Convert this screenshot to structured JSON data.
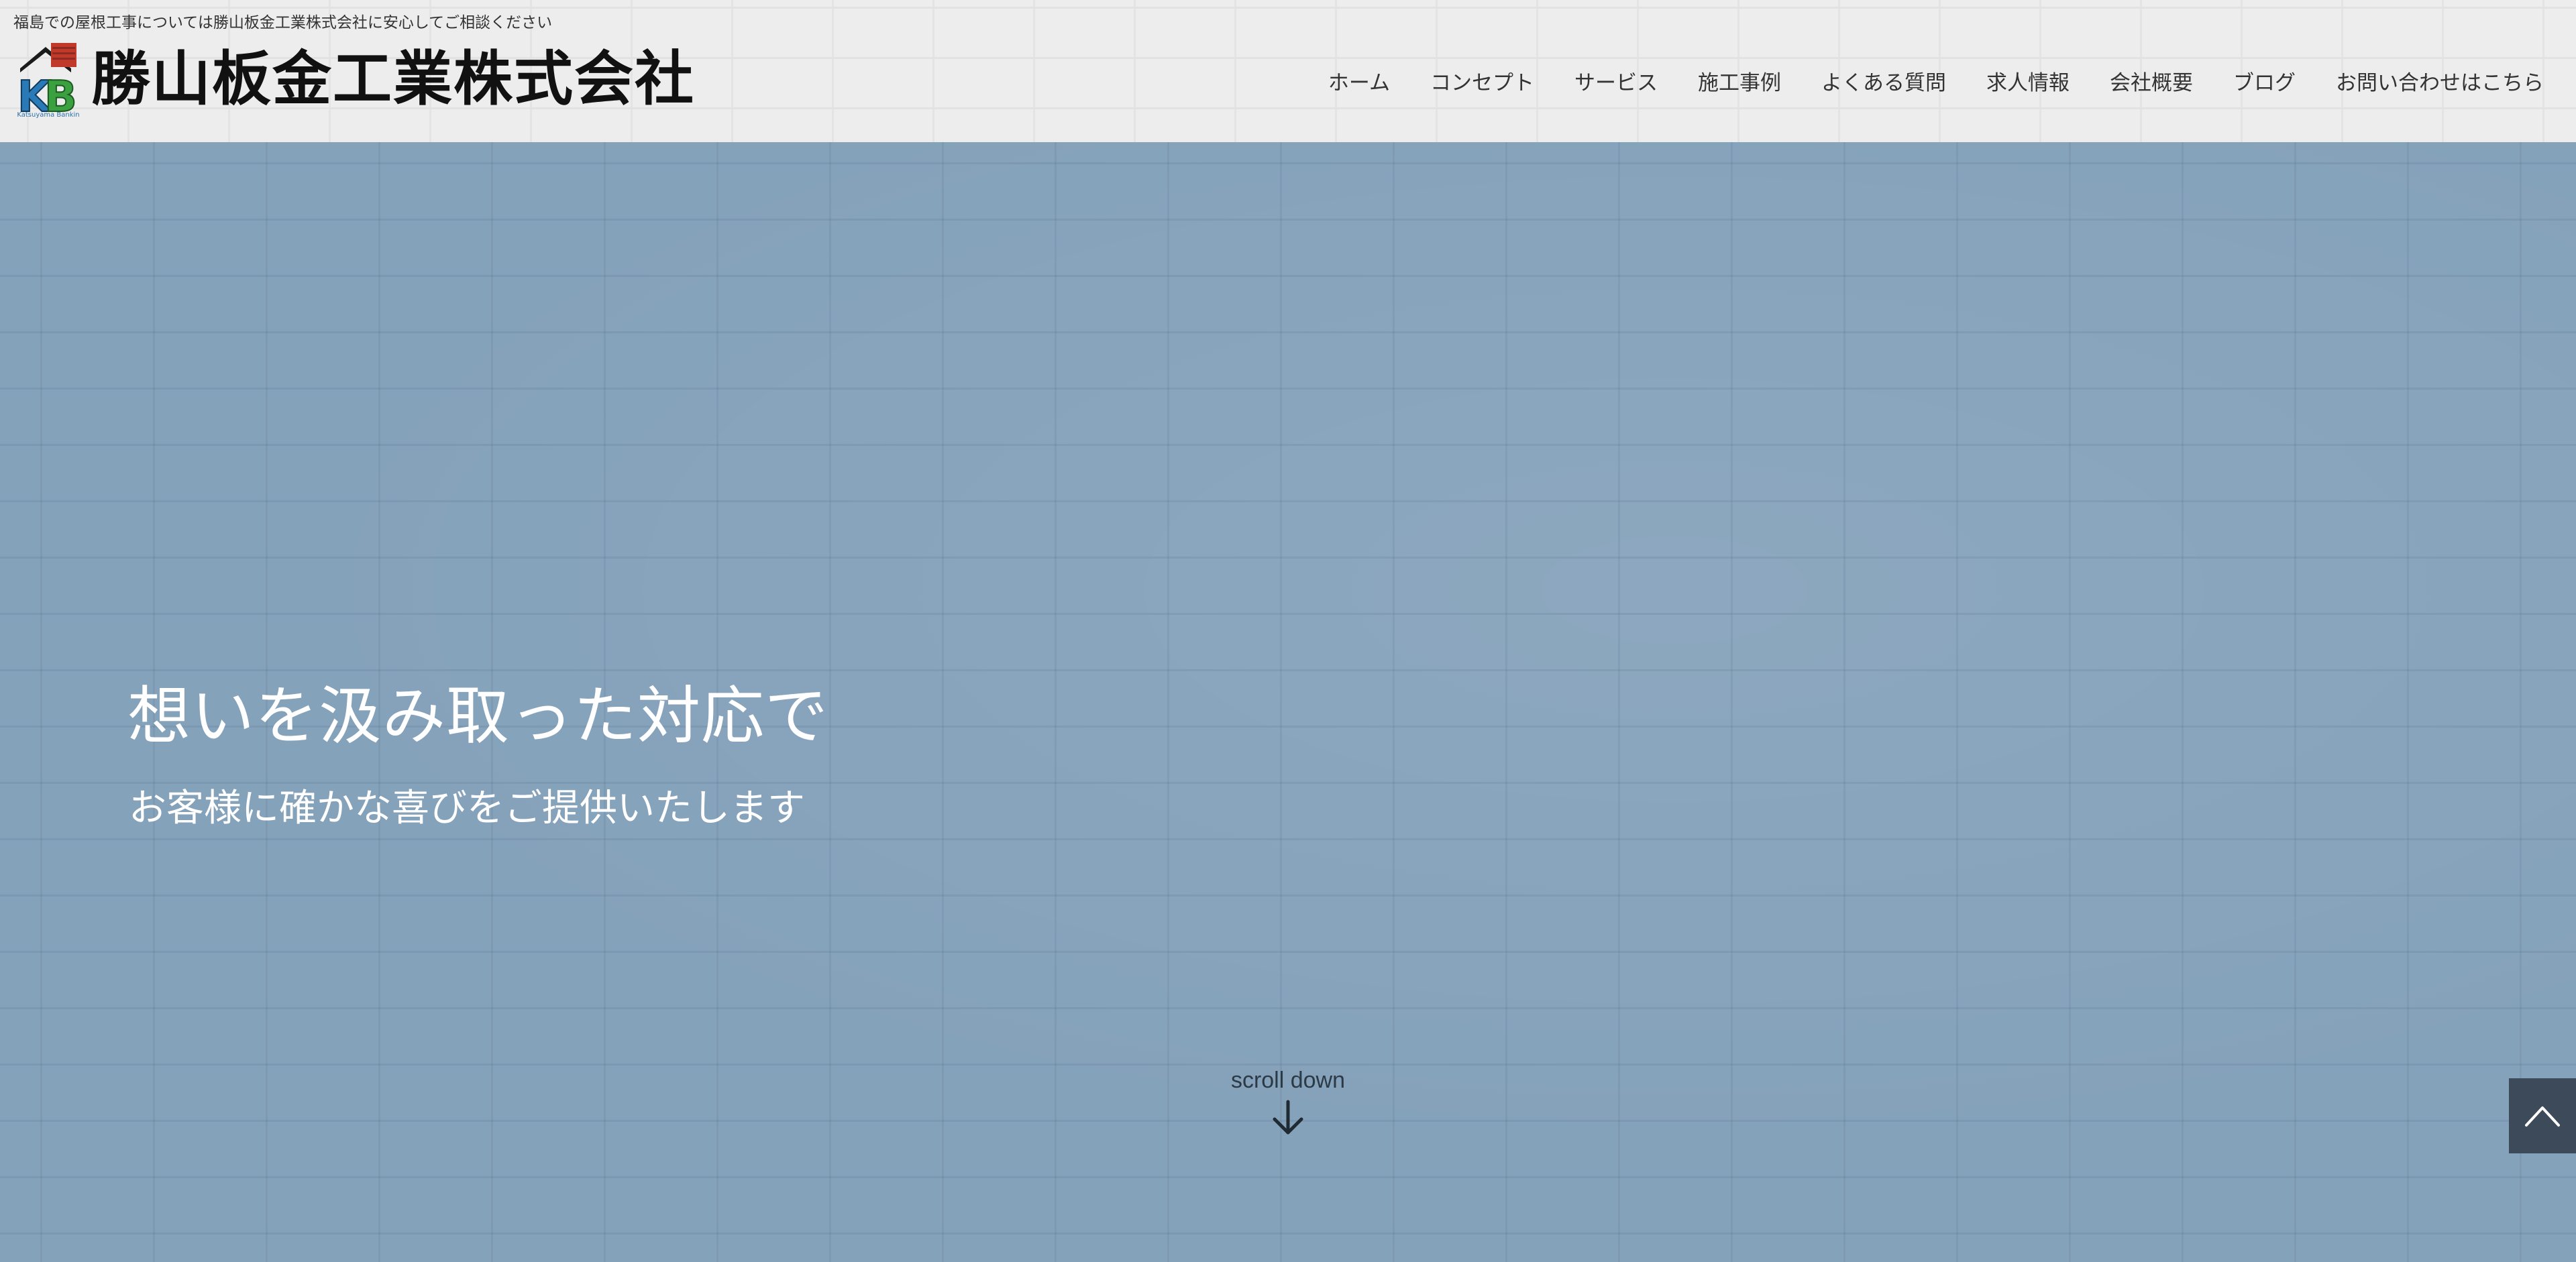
{
  "header": {
    "tagline": "福島での屋根工事については勝山板金工業株式会社に安心してご相談ください",
    "logo_caption": "Katsuyama Bankin",
    "brand_name": "勝山板金工業株式会社"
  },
  "nav": {
    "items": [
      {
        "label": "ホーム"
      },
      {
        "label": "コンセプト"
      },
      {
        "label": "サービス"
      },
      {
        "label": "施工事例"
      },
      {
        "label": "よくある質問"
      },
      {
        "label": "求人情報"
      },
      {
        "label": "会社概要"
      },
      {
        "label": "ブログ"
      },
      {
        "label": "お問い合わせはこちら"
      }
    ]
  },
  "hero": {
    "heading": "想いを汲み取った対応で",
    "subheading": "お客様に確かな喜びをご提供いたします",
    "scroll_label": "scroll down"
  },
  "icons": {
    "logo": "kb-house-logo",
    "scroll": "arrow-down-icon",
    "to_top": "chevron-up-icon"
  },
  "colors": {
    "hero_bg": "#85a2bb",
    "header_bg": "#ededed",
    "to_top_bg": "#3c4a5a",
    "logo_red": "#c0392b",
    "logo_blue": "#2a7ab8",
    "logo_green": "#3aa040"
  }
}
